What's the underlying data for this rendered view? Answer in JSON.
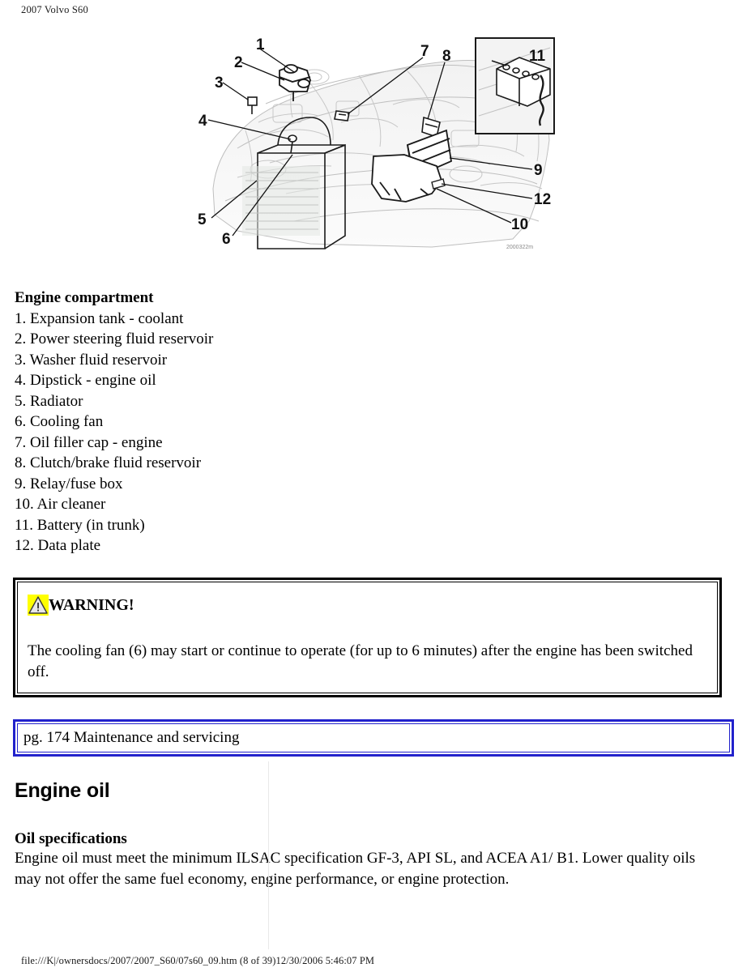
{
  "page": {
    "header": "2007 Volvo S60",
    "footer": "file:///K|/ownersdocs/2007/2007_S60/07s60_09.htm (8 of 39)12/30/2006 5:46:07 PM"
  },
  "figure": {
    "alt": "Engine compartment diagram with numbered callouts",
    "watermark": "2000322m",
    "callouts": [
      "1",
      "2",
      "3",
      "4",
      "5",
      "6",
      "7",
      "8",
      "9",
      "10",
      "11",
      "12"
    ],
    "inset_label": "11"
  },
  "parts": {
    "heading": "Engine compartment",
    "items": [
      "1. Expansion tank - coolant",
      "2. Power steering fluid reservoir",
      "3. Washer fluid reservoir",
      "4. Dipstick - engine oil",
      "5. Radiator",
      "6. Cooling fan",
      "7. Oil filler cap - engine",
      "8. Clutch/brake fluid reservoir",
      "9. Relay/fuse box",
      "10. Air cleaner",
      "11. Battery (in trunk)",
      "12. Data plate"
    ]
  },
  "warning": {
    "title": "WARNING!",
    "body": "The cooling fan (6) may start or continue to operate (for up to 6 minutes) after the engine has been switched off.",
    "icon_bg": "#ffff00",
    "border_color": "#000000"
  },
  "page_ref": {
    "text": "pg. 174 Maintenance and servicing",
    "border_color": "#2222cc"
  },
  "engine_oil": {
    "section_title": "Engine oil",
    "sub_title": "Oil specifications",
    "paragraph": "Engine oil must meet the minimum ILSAC specification GF-3, API SL, and ACEA A1/ B1. Lower quality oils may not offer the same fuel economy, engine performance, or engine protection."
  }
}
